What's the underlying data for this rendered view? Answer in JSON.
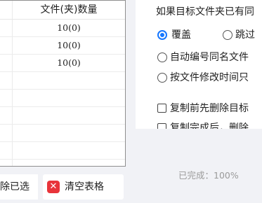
{
  "file_table": {
    "columns": [
      "文件(夹)数量"
    ],
    "rows": [
      {
        "count": "10(0)"
      },
      {
        "count": "10(0)"
      },
      {
        "count": "10(0)"
      }
    ]
  },
  "buttons": {
    "delete_selected": "除已选",
    "clear_table": "清空表格",
    "clear_table_icon": "red-x-icon"
  },
  "options": {
    "conflict_heading": "如果目标文件夹已有同",
    "overwrite_label": "覆盖",
    "skip_label": "跳过",
    "selected_mode": "overwrite",
    "auto_rename_label": "自动编号同名文件",
    "modified_time_label": "按文件修改时间只",
    "delete_before_copy_label": "复制前先删除目标",
    "delete_after_copy_label": "复制完成后，删除",
    "delete_before_copy_checked": false,
    "delete_after_copy_checked": false
  },
  "status": {
    "completed_text": "已完成：100%",
    "completed_percent": 100
  },
  "colors": {
    "accent": "#1677ff",
    "danger": "#e8343a",
    "muted_text": "#9a9a9a"
  }
}
